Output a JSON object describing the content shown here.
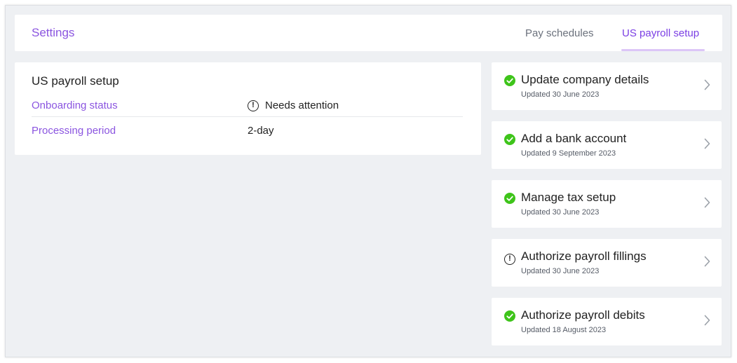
{
  "header": {
    "title": "Settings",
    "tabs": [
      {
        "label": "Pay schedules",
        "active": false
      },
      {
        "label": "US payroll setup",
        "active": true
      }
    ]
  },
  "colors": {
    "accent": "#8b55e0",
    "active_tab": "#7b3fe4",
    "success": "#3ec41a",
    "background": "#eef0f3"
  },
  "setup_card": {
    "title": "US payroll setup",
    "rows": [
      {
        "label": "Onboarding status",
        "value": "Needs attention",
        "icon": "alert-circle-icon"
      },
      {
        "label": "Processing period",
        "value": "2-day"
      }
    ]
  },
  "steps": [
    {
      "title": "Update company details",
      "subtitle": "Updated 30 June 2023",
      "status": "complete",
      "icon": "check-circle-icon"
    },
    {
      "title": "Add a bank account",
      "subtitle": "Updated 9 September 2023",
      "status": "complete",
      "icon": "check-circle-icon"
    },
    {
      "title": "Manage tax setup",
      "subtitle": "Updated 30 June 2023",
      "status": "complete",
      "icon": "check-circle-icon"
    },
    {
      "title": "Authorize payroll fillings",
      "subtitle": "Updated 30 June 2023",
      "status": "attention",
      "icon": "alert-circle-icon"
    },
    {
      "title": "Authorize payroll debits",
      "subtitle": "Updated 18 August 2023",
      "status": "complete",
      "icon": "check-circle-icon"
    }
  ]
}
